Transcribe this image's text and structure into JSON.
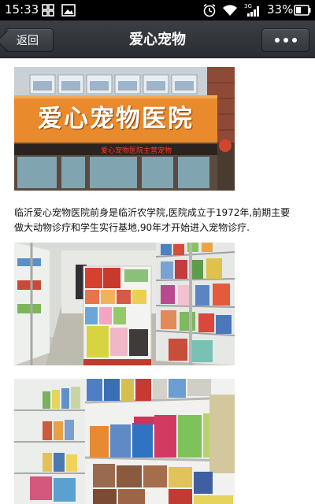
{
  "status_bar": {
    "time": "15:33",
    "battery_percent": "33%",
    "network_type": "3G",
    "icons": [
      "grid-icon",
      "image-icon",
      "alarm-icon",
      "wifi-icon",
      "signal-icon",
      "battery-icon"
    ]
  },
  "header": {
    "back_label": "返回",
    "title": "爱心宠物",
    "more_icon": "more-dots-icon"
  },
  "article": {
    "sign_text": "爱心宠物医院",
    "led_text": "爱心宠物医院主营宠物",
    "paragraph": "临沂爱心宠物医院前身是临沂农学院,医院成立于1972年,前期主要做大动物诊疗和学生实行基地,90年才开始进入宠物诊疗."
  },
  "colors": {
    "header_bg": "#2f3236",
    "status_bg": "#000000",
    "sign_orange": "#e98a2c"
  }
}
